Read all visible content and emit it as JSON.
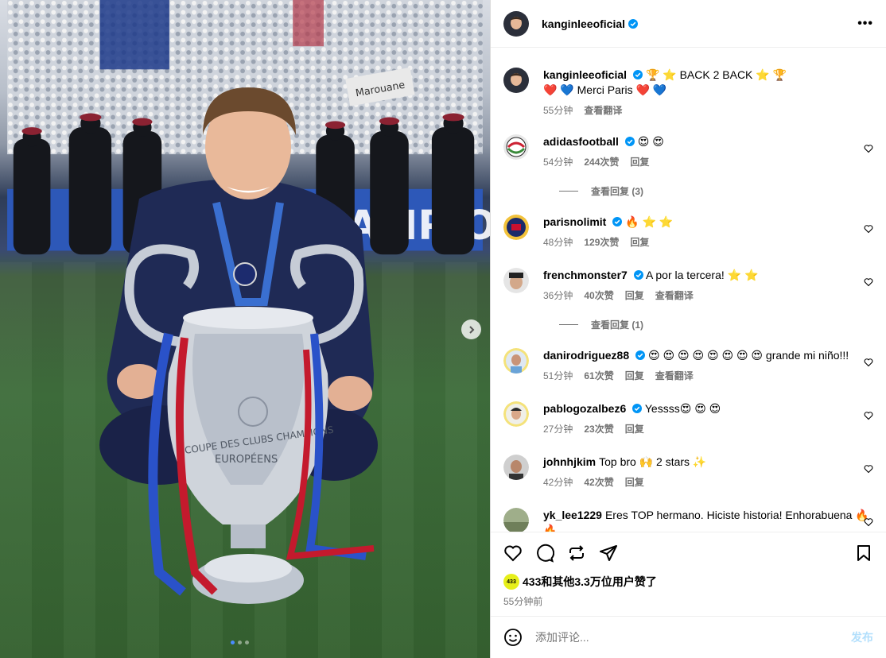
{
  "post": {
    "author": "kanginleeoficial",
    "more_icon": "more-horizontal-icon"
  },
  "caption": {
    "user": "kanginleeoficial",
    "line1": "🏆 ⭐ BACK 2 BACK ⭐ 🏆",
    "line2": "❤️ 💙 Merci Paris ❤️ 💙",
    "time": "55分钟",
    "translate": "查看翻译"
  },
  "comments": [
    {
      "user": "adidasfootball",
      "verified": true,
      "text": "😍 😍",
      "time": "54分钟",
      "likes": "244次赞",
      "reply": "回复",
      "translate": ""
    },
    {
      "user": "parisnolimit",
      "verified": true,
      "text": "🔥 ⭐ ⭐",
      "time": "48分钟",
      "likes": "129次赞",
      "reply": "回复",
      "translate": ""
    },
    {
      "user": "frenchmonster7",
      "verified": true,
      "text": "A por la tercera! ⭐ ⭐",
      "time": "36分钟",
      "likes": "40次赞",
      "reply": "回复",
      "translate": "查看翻译"
    },
    {
      "user": "danirodriguez88",
      "verified": true,
      "text": "😍 😍 😍 😍 😍 😍 😍 😍 grande mi niño!!!",
      "time": "51分钟",
      "likes": "61次赞",
      "reply": "回复",
      "translate": "查看翻译"
    },
    {
      "user": "pablogozalbez6",
      "verified": true,
      "text": "Yessss😍 😍 😍",
      "time": "27分钟",
      "likes": "23次赞",
      "reply": "回复",
      "translate": ""
    },
    {
      "user": "johnhjkim",
      "verified": false,
      "text": "Top bro 🙌 2 stars ✨",
      "time": "42分钟",
      "likes": "42次赞",
      "reply": "回复",
      "translate": ""
    },
    {
      "user": "yk_lee1229",
      "verified": false,
      "text": "Eres TOP hermano. Hiciste historia! Enhorabuena 🔥 🔥",
      "time": "",
      "likes": "",
      "reply": "",
      "translate": ""
    }
  ],
  "replies": [
    {
      "label": "查看回复 (3)"
    },
    {
      "label": "查看回复 (1)"
    }
  ],
  "actions": {
    "likes_text": "433和其他3.3万位用户赞了",
    "liker_badge": "433",
    "posted": "55分钟前"
  },
  "add_comment": {
    "placeholder": "添加评论...",
    "post_label": "发布"
  },
  "photo": {
    "trophy_text_1": "COUPE DES CLUBS CHAMPIONS",
    "trophy_text_2": "EUROPÉENS",
    "banner": "Marouane",
    "board": "AMPIO"
  },
  "colors": {
    "verified": "#0095f6",
    "muted": "#737373",
    "post_button": "#b2dffc"
  }
}
